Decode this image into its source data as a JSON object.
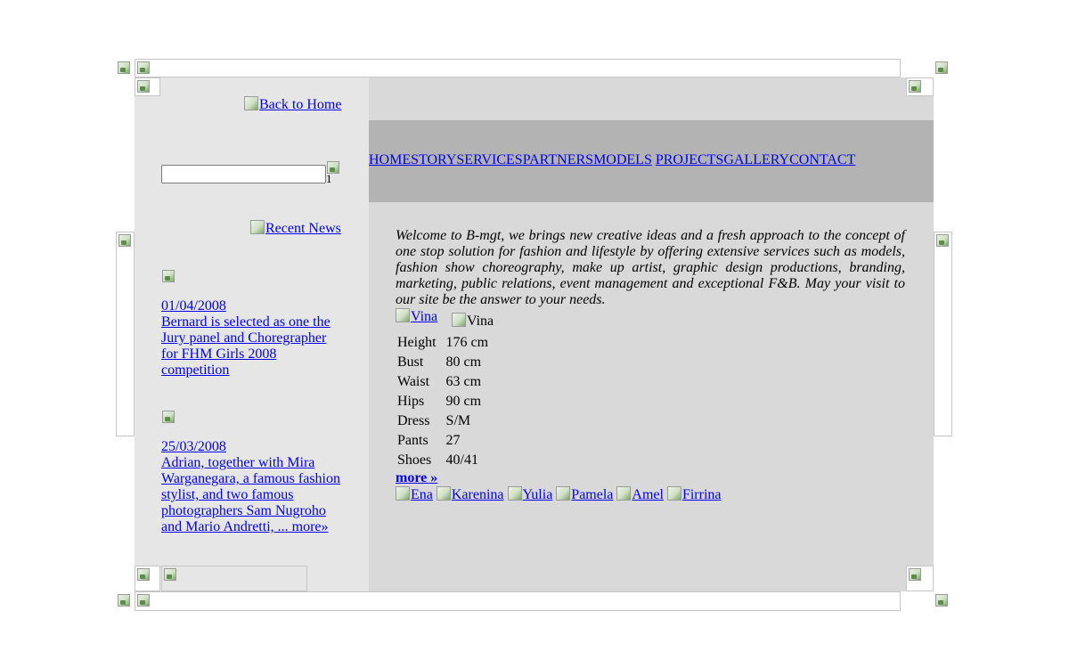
{
  "sidebar": {
    "back_home": "Back to Home",
    "search_value": "",
    "search_button_alt": "1",
    "recent_news": "Recent News",
    "news": [
      {
        "date": "01/04/2008",
        "text": "Bernard is selected as one the Jury panel and Choregrapher for FHM Girls 2008 competition"
      },
      {
        "date": "25/03/2008",
        "text": "Adrian, together with Mira Warganegara, a famous fashion stylist, and two famous photographers Sam Nugroho and Mario Andretti, ... more»"
      }
    ]
  },
  "nav": {
    "items": [
      "HOME",
      "STORY",
      "SERVICES",
      "PARTNERS",
      "MODELS",
      "PROJECTS",
      "GALLERY",
      "CONTACT"
    ]
  },
  "main": {
    "welcome": "Welcome to B-mgt, we brings new creative ideas and a fresh approach to the concept of one stop solution for fashion and lifestyle by offering extensive services such as models, fashion show choreography, make up artist, graphic design productions, branding, marketing, public relations, event management and exceptional F&B. May your visit to our site be the answer to your needs.",
    "model_photo_alt": "Vina",
    "model_name_alt": "Vina",
    "stats": [
      {
        "label": "Height",
        "value": "176 cm"
      },
      {
        "label": "Bust",
        "value": "80 cm"
      },
      {
        "label": "Waist",
        "value": "63 cm"
      },
      {
        "label": "Hips",
        "value": "90 cm"
      },
      {
        "label": "Dress",
        "value": "S/M"
      },
      {
        "label": "Pants",
        "value": "27"
      },
      {
        "label": "Shoes",
        "value": "40/41"
      }
    ],
    "more": "more »",
    "other_models": [
      "Ena",
      "Karenina",
      "Yulia",
      "Pamela",
      "Amel",
      "Firrina"
    ]
  }
}
